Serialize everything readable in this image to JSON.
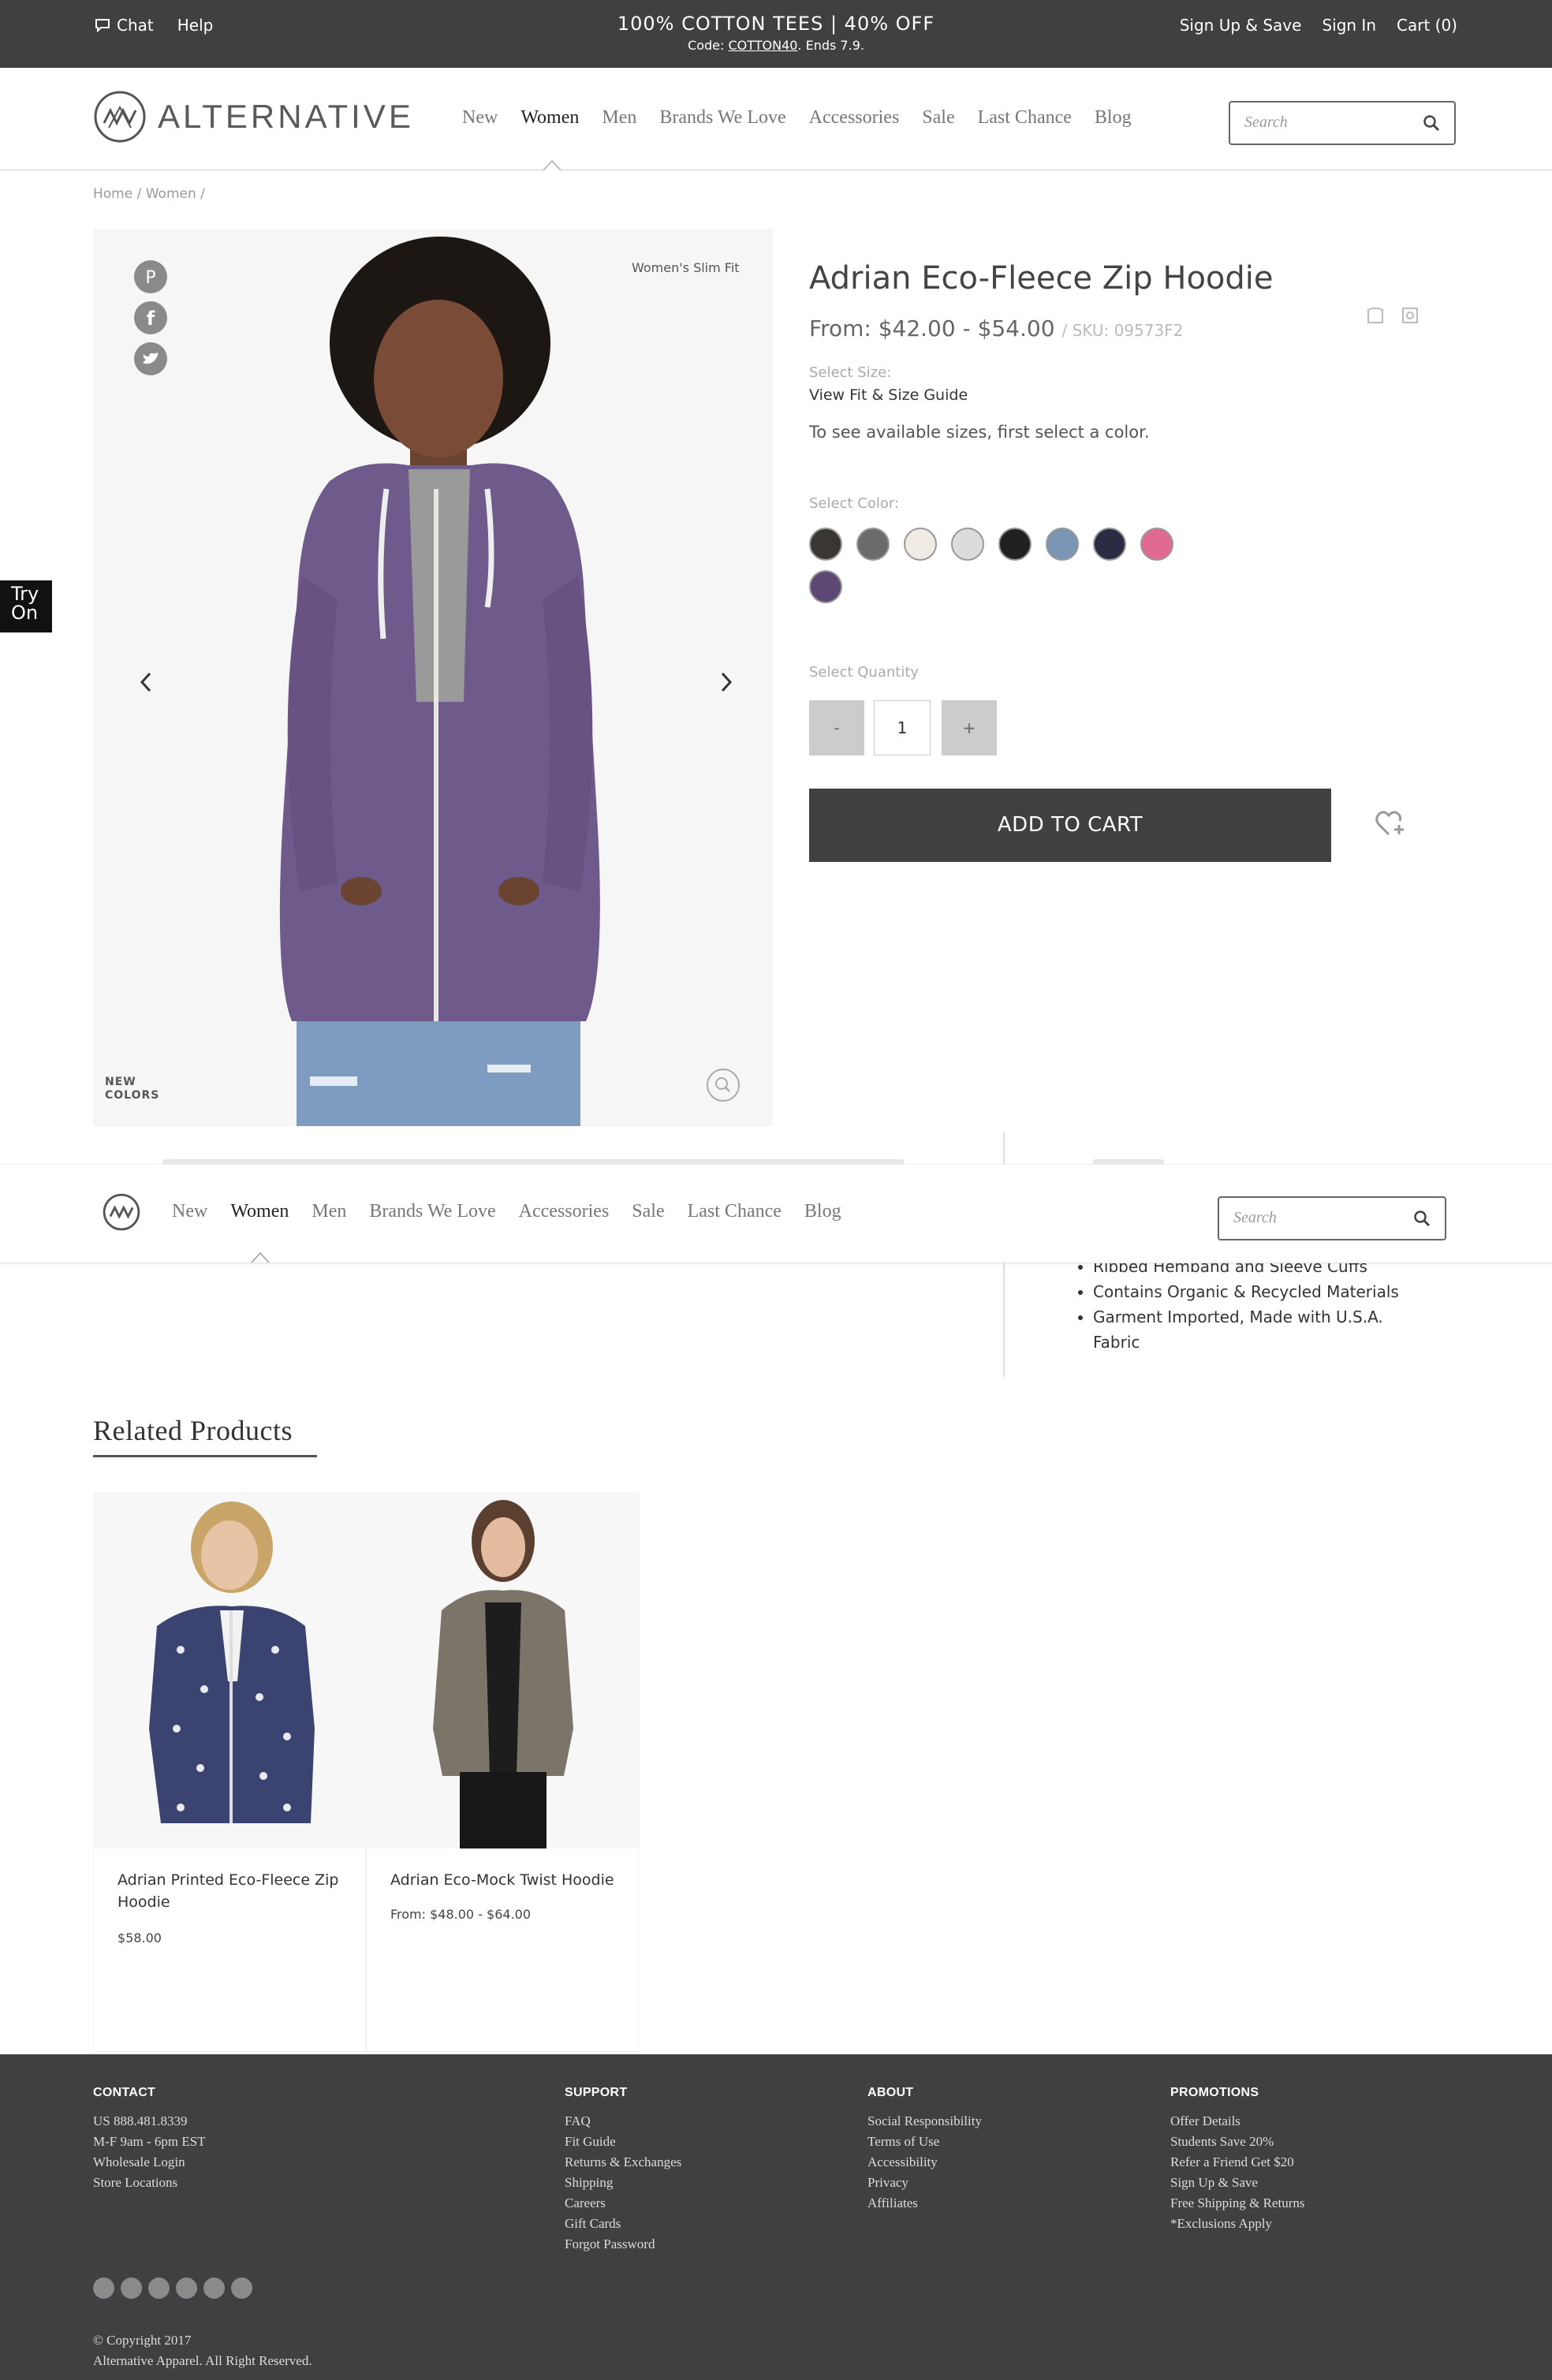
{
  "promo": {
    "chat": "Chat",
    "help": "Help",
    "headline": "100% COTTON TEES | 40% OFF",
    "code_prefix": "Code: ",
    "code": "COTTON40",
    "code_suffix": ". Ends 7.9.",
    "signup": "Sign Up & Save",
    "signin": "Sign In",
    "cart": "Cart (0)"
  },
  "brand": {
    "name": "ALTERNATIVE"
  },
  "nav": [
    "New",
    "Women",
    "Men",
    "Brands We Love",
    "Accessories",
    "Sale",
    "Last Chance",
    "Blog"
  ],
  "search": {
    "placeholder": "Search"
  },
  "breadcrumb": "Home / Women /",
  "product": {
    "fit_tag": "Women's Slim Fit",
    "new_colors_1": "NEW",
    "new_colors_2": "COLORS",
    "title": "Adrian Eco-Fleece Zip Hoodie",
    "price": "From: $42.00 - $54.00",
    "sku": "/ SKU: 09573F2",
    "select_size": "Select Size:",
    "fit_guide": "View Fit & Size Guide",
    "size_hint": "To see available sizes, first select a color.",
    "select_color": "Select Color:",
    "colors": [
      "#3a3633",
      "#6d6b6a",
      "#f0ece4",
      "#dcdcdc",
      "#222120",
      "#7b96b4",
      "#2b2b44",
      "#e06a93",
      "#5d4873"
    ],
    "select_quantity": "Select Quantity",
    "qty_minus": "-",
    "qty_value": "1",
    "qty_plus": "+",
    "add_to_cart": "ADD TO CART",
    "try_on_1": "Try",
    "try_on_2": "On"
  },
  "features": [
    "Ribbed Hemband and Sleeve Cuffs",
    "Contains Organic & Recycled Materials",
    "Garment Imported, Made with U.S.A.",
    "Fabric"
  ],
  "related": {
    "title": "Related Products",
    "items": [
      {
        "name": "Adrian Printed Eco-Fleece Zip Hoodie",
        "price": "$58.00"
      },
      {
        "name": "Adrian Eco-Mock Twist Hoodie",
        "price": "From: $48.00 - $64.00"
      }
    ]
  },
  "footer": {
    "contact": {
      "title": "CONTACT",
      "items": [
        "US 888.481.8339",
        "M-F 9am - 6pm EST",
        "Wholesale Login",
        "Store Locations"
      ]
    },
    "support": {
      "title": "SUPPORT",
      "items": [
        "FAQ",
        "Fit Guide",
        "Returns & Exchanges",
        "Shipping",
        "Careers",
        "Gift Cards",
        "Forgot Password"
      ]
    },
    "about": {
      "title": "ABOUT",
      "items": [
        "Social Responsibility",
        "Terms of Use",
        "Accessibility",
        "Privacy",
        "Affiliates"
      ]
    },
    "promotions": {
      "title": "PROMOTIONS",
      "items": [
        "Offer Details",
        "Students Save 20%",
        "Refer a Friend Get $20",
        "Sign Up & Save",
        "Free Shipping & Returns",
        "*Exclusions Apply"
      ]
    },
    "copyright_1": "© Copyright 2017",
    "copyright_2": "Alternative Apparel. All Right Reserved."
  },
  "icons": {
    "social_share": [
      "pinterest-icon",
      "facebook-icon",
      "twitter-icon"
    ],
    "footer_social": [
      "facebook-icon",
      "pinterest-icon",
      "twitter-icon",
      "instagram-icon",
      "youtube-icon",
      "tumblr-icon"
    ]
  }
}
